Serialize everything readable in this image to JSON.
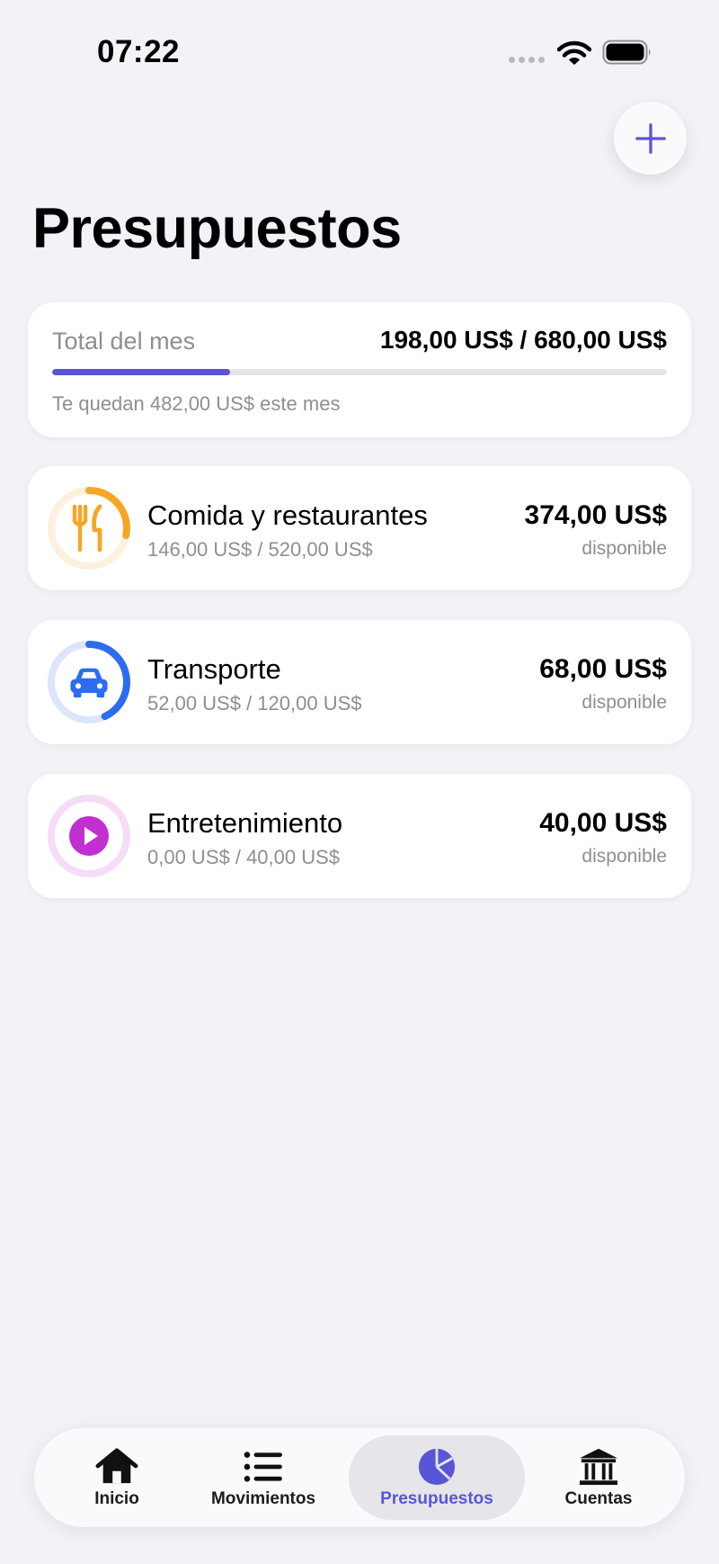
{
  "status_bar": {
    "time": "07:22"
  },
  "colors": {
    "accent": "#5856d6",
    "food": "#f5a623",
    "transport": "#2c6cf0",
    "entertainment": "#c22fd1"
  },
  "header": {
    "title": "Presupuestos"
  },
  "total": {
    "label": "Total del mes",
    "amount": "198,00 US$ / 680,00 US$",
    "progress_fraction": 0.29,
    "remaining": "Te quedan 482,00 US$ este mes"
  },
  "budgets": [
    {
      "name": "Comida y restaurantes",
      "spent": "146,00 US$ / 520,00 US$",
      "available": "374,00 US$",
      "caption": "disponible",
      "icon": "fork-knife-icon",
      "fraction": 0.28
    },
    {
      "name": "Transporte",
      "spent": "52,00 US$ / 120,00 US$",
      "available": "68,00 US$",
      "caption": "disponible",
      "icon": "car-icon",
      "fraction": 0.43
    },
    {
      "name": "Entretenimiento",
      "spent": "0,00 US$ / 40,00 US$",
      "available": "40,00 US$",
      "caption": "disponible",
      "icon": "play-icon",
      "fraction": 0.0
    }
  ],
  "tabs": [
    {
      "label": "Inicio",
      "icon": "house-icon",
      "active": false
    },
    {
      "label": "Movimientos",
      "icon": "list-icon",
      "active": false
    },
    {
      "label": "Presupuestos",
      "icon": "pie-chart-icon",
      "active": true
    },
    {
      "label": "Cuentas",
      "icon": "bank-icon",
      "active": false
    }
  ]
}
